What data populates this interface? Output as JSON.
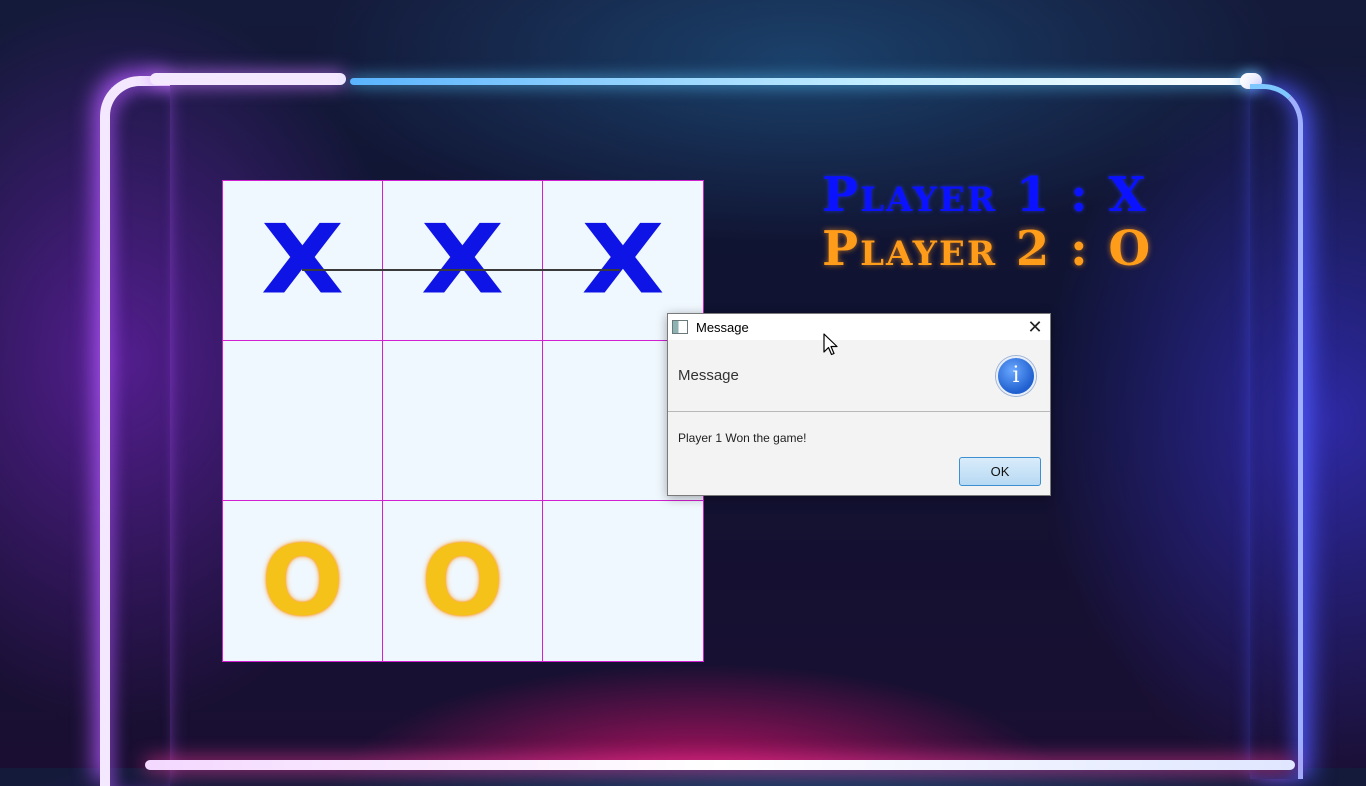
{
  "players": {
    "player1": "Player 1 : X",
    "player2": "Player 2 : O"
  },
  "board": {
    "cells": [
      "X",
      "X",
      "X",
      "",
      "",
      "",
      "O",
      "O",
      ""
    ]
  },
  "dialog": {
    "title": "Message",
    "header": "Message",
    "content": "Player 1 Won the game!",
    "ok_label": "OK"
  },
  "colors": {
    "x_mark": "#0f14e6",
    "o_mark": "#f5c21a",
    "grid_line": "#d21fd2",
    "board_bg": "#f0f8ff",
    "player1_text": "#0a12ff",
    "player2_text": "#ff9d1a"
  },
  "icons": {
    "dialog_app": "java-app-icon",
    "dialog_close": "close-icon",
    "dialog_info": "info-icon",
    "pointer": "mouse-pointer-icon"
  }
}
